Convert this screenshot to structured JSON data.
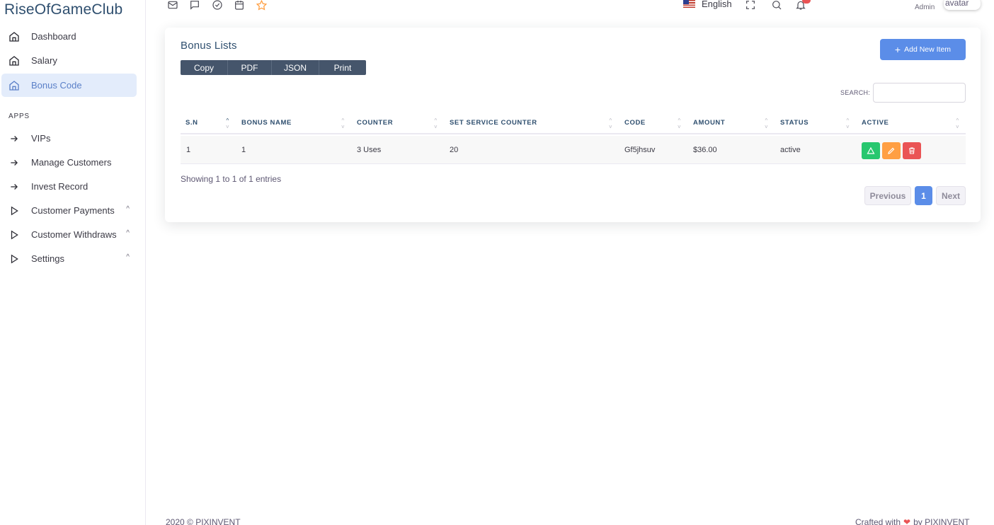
{
  "sidebar": {
    "brand": "RiseOfGameClub",
    "section_header": "APPS",
    "items": [
      {
        "label": "Dashboard",
        "icon": "home-icon"
      },
      {
        "label": "Salary",
        "icon": "home-icon"
      },
      {
        "label": "Bonus Code",
        "icon": "home-icon",
        "active": true
      },
      {
        "label": "VIPs",
        "icon": "arrow-right-icon"
      },
      {
        "label": "Manage Customers",
        "icon": "arrow-right-icon"
      },
      {
        "label": "Invest Record",
        "icon": "arrow-right-icon"
      },
      {
        "label": "Customer Payments",
        "icon": "play-icon",
        "chevron": "^"
      },
      {
        "label": "Customer Withdraws",
        "icon": "play-icon",
        "chevron": "^"
      },
      {
        "label": "Settings",
        "icon": "play-icon",
        "chevron": "^"
      }
    ]
  },
  "topbar": {
    "icons": [
      "mail-icon",
      "chat-icon",
      "check-circle-icon",
      "calendar-icon",
      "star-icon"
    ],
    "language": "English",
    "user_role": "Admin",
    "avatar_alt": "avatar"
  },
  "card": {
    "title": "Bonus Lists",
    "export_buttons": [
      "Copy",
      "PDF",
      "JSON",
      "Print"
    ],
    "add_button": "Add New Item",
    "search_label": "SEARCH:",
    "search_value": "",
    "columns": [
      "S.N",
      "BONUS NAME",
      "COUNTER",
      "SET SERVICE COUNTER",
      "CODE",
      "AMOUNT",
      "STATUS",
      "ACTIVE"
    ],
    "rows": [
      {
        "sn": "1",
        "bonus_name": "1",
        "counter": "3 Uses",
        "set_service_counter": "20",
        "code": "Gf5jhsuv",
        "amount": "$36.00",
        "status": "active"
      }
    ],
    "info": "Showing 1 to 1 of 1 entries",
    "pagination": {
      "previous": "Previous",
      "page": "1",
      "next": "Next"
    }
  },
  "footer": {
    "left": "2020 © PIXINVENT",
    "right_prefix": "Crafted with",
    "right_suffix": "by PIXINVENT"
  },
  "colors": {
    "accent": "#5b8de8",
    "active_bg": "#e3ecfb",
    "green": "#28c76f",
    "orange": "#ff9f43",
    "red": "#ea5455",
    "export_bg": "#45556b"
  }
}
